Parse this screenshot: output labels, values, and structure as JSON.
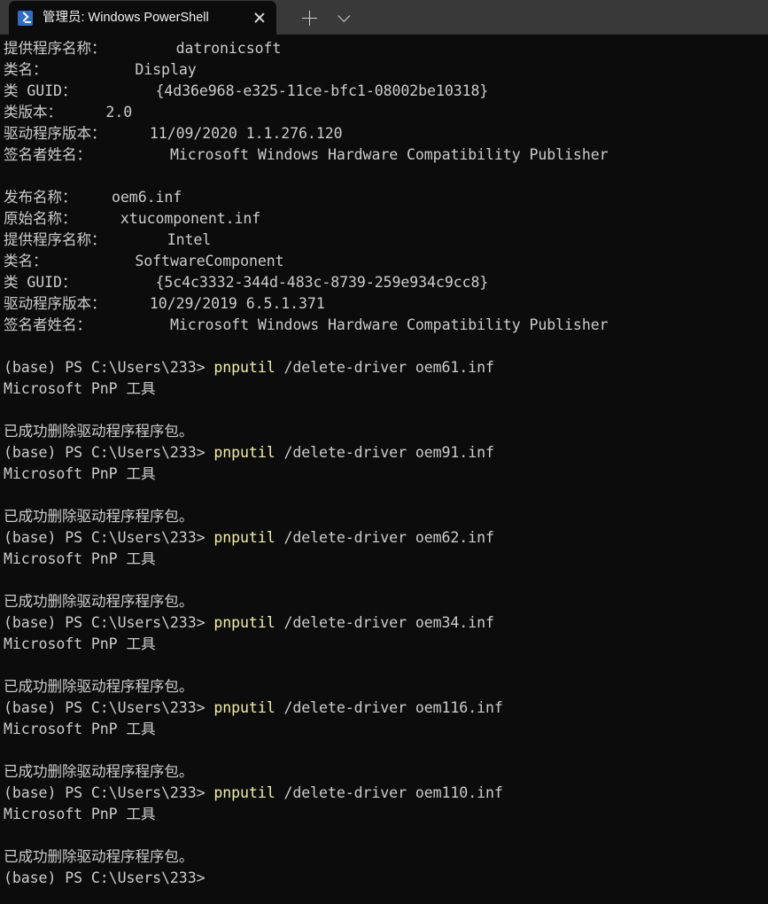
{
  "window": {
    "title": "管理员: Windows PowerShell",
    "tab_icon": "powershell-icon",
    "close_label": "✕",
    "new_tab_label": "+",
    "dropdown_label": "⌄",
    "colors": {
      "titlebar_bg": "#393939",
      "tab_bg": "#0c0c0c",
      "console_bg": "#0c0c0c",
      "text_fg": "#cccccc",
      "command_fg": "#f0eda8",
      "icon_blue": "#2f6ec4"
    }
  },
  "console": {
    "prompt": "(base) PS C:\\Users\\233>",
    "lines": [
      {
        "text": "提供程序名称：        datronicsoft",
        "color": "default"
      },
      {
        "text": "类名：          Display",
        "color": "default"
      },
      {
        "text": "类 GUID：         {4d36e968-e325-11ce-bfc1-08002be10318}",
        "color": "default"
      },
      {
        "text": "类版本：     2.0",
        "color": "default"
      },
      {
        "text": "驱动程序版本：     11/09/2020 1.1.276.120",
        "color": "default"
      },
      {
        "text": "签名者姓名：         Microsoft Windows Hardware Compatibility Publisher",
        "color": "default"
      },
      {
        "text": "",
        "color": "default"
      },
      {
        "text": "发布名称：    oem6.inf",
        "color": "default"
      },
      {
        "text": "原始名称：     xtucomponent.inf",
        "color": "default"
      },
      {
        "text": "提供程序名称：       Intel",
        "color": "default"
      },
      {
        "text": "类名：          SoftwareComponent",
        "color": "default"
      },
      {
        "text": "类 GUID：         {5c4c3332-344d-483c-8739-259e934c9cc8}",
        "color": "default"
      },
      {
        "text": "驱动程序版本：     10/29/2019 6.5.1.371",
        "color": "default"
      },
      {
        "text": "签名者姓名：         Microsoft Windows Hardware Compatibility Publisher",
        "color": "default"
      },
      {
        "text": "",
        "color": "default"
      },
      {
        "segments": [
          {
            "text": "(base) PS C:\\Users\\233> ",
            "color": "default"
          },
          {
            "text": "pnputil",
            "color": "yellow"
          },
          {
            "text": " /delete-driver oem61.inf",
            "color": "default"
          }
        ]
      },
      {
        "text": "Microsoft PnP 工具",
        "color": "default"
      },
      {
        "text": "",
        "color": "default"
      },
      {
        "text": "已成功删除驱动程序程序包。",
        "color": "default"
      },
      {
        "segments": [
          {
            "text": "(base) PS C:\\Users\\233> ",
            "color": "default"
          },
          {
            "text": "pnputil",
            "color": "yellow"
          },
          {
            "text": " /delete-driver oem91.inf",
            "color": "default"
          }
        ]
      },
      {
        "text": "Microsoft PnP 工具",
        "color": "default"
      },
      {
        "text": "",
        "color": "default"
      },
      {
        "text": "已成功删除驱动程序程序包。",
        "color": "default"
      },
      {
        "segments": [
          {
            "text": "(base) PS C:\\Users\\233> ",
            "color": "default"
          },
          {
            "text": "pnputil",
            "color": "yellow"
          },
          {
            "text": " /delete-driver oem62.inf",
            "color": "default"
          }
        ]
      },
      {
        "text": "Microsoft PnP 工具",
        "color": "default"
      },
      {
        "text": "",
        "color": "default"
      },
      {
        "text": "已成功删除驱动程序程序包。",
        "color": "default"
      },
      {
        "segments": [
          {
            "text": "(base) PS C:\\Users\\233> ",
            "color": "default"
          },
          {
            "text": "pnputil",
            "color": "yellow"
          },
          {
            "text": " /delete-driver oem34.inf",
            "color": "default"
          }
        ]
      },
      {
        "text": "Microsoft PnP 工具",
        "color": "default"
      },
      {
        "text": "",
        "color": "default"
      },
      {
        "text": "已成功删除驱动程序程序包。",
        "color": "default"
      },
      {
        "segments": [
          {
            "text": "(base) PS C:\\Users\\233> ",
            "color": "default"
          },
          {
            "text": "pnputil",
            "color": "yellow"
          },
          {
            "text": " /delete-driver oem116.inf",
            "color": "default"
          }
        ]
      },
      {
        "text": "Microsoft PnP 工具",
        "color": "default"
      },
      {
        "text": "",
        "color": "default"
      },
      {
        "text": "已成功删除驱动程序程序包。",
        "color": "default"
      },
      {
        "segments": [
          {
            "text": "(base) PS C:\\Users\\233> ",
            "color": "default"
          },
          {
            "text": "pnputil",
            "color": "yellow"
          },
          {
            "text": " /delete-driver oem110.inf",
            "color": "default"
          }
        ]
      },
      {
        "text": "Microsoft PnP 工具",
        "color": "default"
      },
      {
        "text": "",
        "color": "default"
      },
      {
        "text": "已成功删除驱动程序程序包。",
        "color": "default"
      },
      {
        "text": "(base) PS C:\\Users\\233> ",
        "color": "default"
      }
    ]
  }
}
